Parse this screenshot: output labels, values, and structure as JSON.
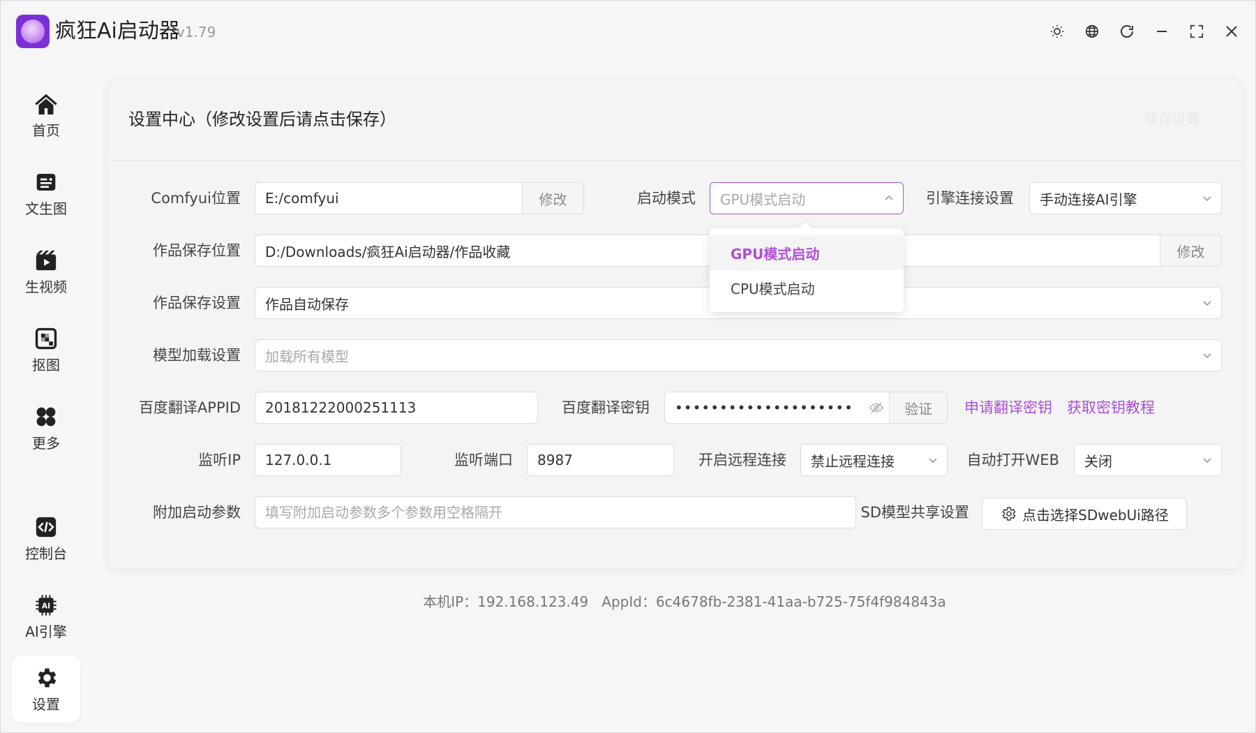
{
  "app": {
    "title": "疯狂Ai启动器",
    "version": "v1.79"
  },
  "titlebar_icons": [
    "theme-icon",
    "language-icon",
    "refresh-icon",
    "minimize-icon",
    "maximize-icon",
    "close-icon"
  ],
  "sidebar": {
    "items": [
      {
        "label": "首页",
        "icon": "home-icon",
        "active": false
      },
      {
        "label": "文生图",
        "icon": "text-to-image-icon",
        "active": false
      },
      {
        "label": "生视频",
        "icon": "video-icon",
        "active": false
      },
      {
        "label": "抠图",
        "icon": "cutout-icon",
        "active": false
      },
      {
        "label": "更多",
        "icon": "more-icon",
        "active": false
      },
      {
        "label": "控制台",
        "icon": "console-icon",
        "active": false
      },
      {
        "label": "AI引擎",
        "icon": "ai-chip-icon",
        "active": false
      },
      {
        "label": "设置",
        "icon": "settings-icon",
        "active": true
      }
    ]
  },
  "panel": {
    "title": "设置中心（修改设置后请点击保存）",
    "save_label": "保存设置"
  },
  "form": {
    "comfyui_location": {
      "label": "Comfyui位置",
      "value": "E:/comfyui",
      "button": "修改"
    },
    "launch_mode": {
      "label": "启动模式",
      "placeholder": "GPU模式启动",
      "options": [
        "GPU模式启动",
        "CPU模式启动"
      ],
      "selected": "GPU模式启动"
    },
    "engine_connection": {
      "label": "引擎连接设置",
      "value": "手动连接AI引擎"
    },
    "works_save_location": {
      "label": "作品保存位置",
      "value": "D:/Downloads/疯狂Ai启动器/作品收藏",
      "button": "修改"
    },
    "works_save_setting": {
      "label": "作品保存设置",
      "value": "作品自动保存"
    },
    "model_loading": {
      "label": "模型加载设置",
      "placeholder": "加载所有模型"
    },
    "baidu_appid": {
      "label": "百度翻译APPID",
      "value": "20181222000251113"
    },
    "baidu_key": {
      "label": "百度翻译密钥",
      "value": "••••••••••••••••••••",
      "button": "验证"
    },
    "apply_key_link": "申请翻译密钥",
    "key_tutorial_link": "获取密钥教程",
    "listen_ip": {
      "label": "监听IP",
      "value": "127.0.0.1"
    },
    "listen_port": {
      "label": "监听端口",
      "value": "8987"
    },
    "remote_connection": {
      "label": "开启远程连接",
      "value": "禁止远程连接"
    },
    "auto_open_web": {
      "label": "自动打开WEB",
      "value": "关闭"
    },
    "extra_args": {
      "label": "附加启动参数",
      "placeholder": "填写附加启动参数多个参数用空格隔开"
    },
    "sd_model_share": {
      "label": "SD模型共享设置",
      "button": "点击选择SDwebUi路径"
    }
  },
  "footer": {
    "text": "本机IP：192.168.123.49   AppId：6c4678fb-2381-41aa-b725-75f4f984843a"
  },
  "colors": {
    "accent": "#b04fd8",
    "link": "#a94fd6",
    "logo_bg": "#7b2fd6"
  }
}
